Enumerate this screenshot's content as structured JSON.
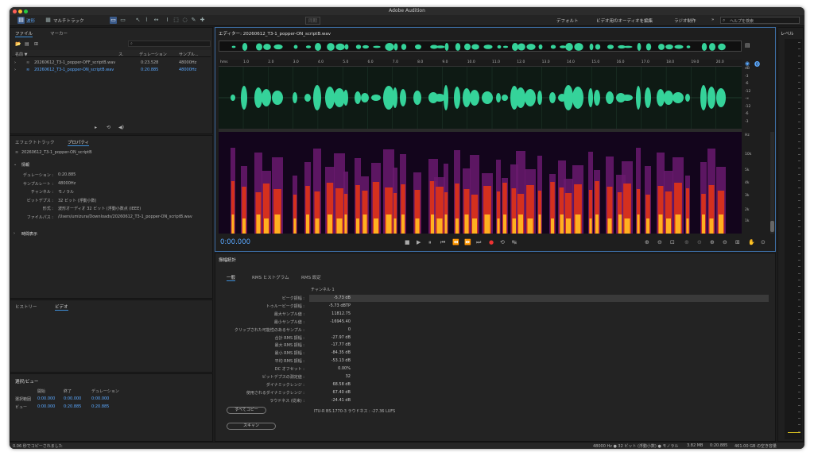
{
  "window": {
    "title": "Adobe Audition"
  },
  "toolbar": {
    "waveform_label": "波形",
    "multitrack_label": "マルチトラック",
    "time_label": "同期",
    "workspaces": [
      "デフォルト",
      "ビデオ用のオーディオを編集",
      "ラジオ制作"
    ],
    "more_label": "»",
    "search_placeholder": "ヘルプを検索"
  },
  "files_panel": {
    "tab_files": "ファイル",
    "tab_markers": "マーカー",
    "columns": [
      "名前 ▼",
      "ス.",
      "デュレーション",
      "サンプル..."
    ],
    "files": [
      {
        "name": "20260612_T3-1_popper-OFF_scriptB.wav",
        "duration": "0:23.528",
        "rate": "48000Hz"
      },
      {
        "name": "20260612_T3-1_popper-ON_scriptB.wav",
        "duration": "0:20.885",
        "rate": "48000Hz"
      }
    ]
  },
  "properties_panel": {
    "tab_effects": "エフェクトトラック",
    "tab_properties": "プロパティ",
    "file_name": "20260612_T3-1_popper-ON_scriptB",
    "section_info": "情報",
    "info": [
      {
        "label": "デュレーション :",
        "value": "0:20.885"
      },
      {
        "label": "サンプルレート :",
        "value": "48000Hz"
      },
      {
        "label": "チャンネル :",
        "value": "モノラル"
      },
      {
        "label": "ビットデプス :",
        "value": "32 ビット (浮動小数)"
      },
      {
        "label": "形式 :",
        "value": "波形オーディオ 32 ビット (浮動小数点 (IEEE)"
      },
      {
        "label": "ファイルパス :",
        "value": "/Users/umizura/Downloads/20260612_T3-1_popper-ON_scriptB.wav"
      }
    ],
    "section_time": "時間表示"
  },
  "history_panel": {
    "tab_history": "ヒストリー",
    "tab_video": "ビデオ"
  },
  "selection_panel": {
    "title": "選択/ビュー",
    "columns": [
      "開始",
      "終了",
      "デュレーション"
    ],
    "rows": [
      {
        "label": "選択範囲",
        "start": "0:00.000",
        "end": "0:00.000",
        "duration": "0:00.000"
      },
      {
        "label": "ビュー",
        "start": "0:00.000",
        "end": "0:20.885",
        "duration": "0:20.885"
      }
    ]
  },
  "editor": {
    "title": "エディター: 20260612_T3-1_popper-ON_scriptB.wav",
    "ruler_unit": "hms",
    "ruler_ticks": [
      "1.0",
      "2.0",
      "3.0",
      "4.0",
      "5.0",
      "6.0",
      "7.0",
      "8.0",
      "9.0",
      "10.0",
      "11.0",
      "12.0",
      "13.0",
      "14.0",
      "15.0",
      "16.0",
      "17.0",
      "18.0",
      "19.0",
      "20.0"
    ],
    "db_scale": [
      "dB",
      "-3",
      "-6",
      "-12",
      "-∞",
      "-12",
      "-6",
      "-3"
    ],
    "hz_scale": [
      "Hz",
      "10k",
      "5k",
      "4k",
      "3k",
      "2k",
      "1k"
    ],
    "timecode": "0:00.000",
    "wave_color": "#35d39a"
  },
  "stats": {
    "title": "振幅統計",
    "tabs": [
      "一般",
      "RMS ヒストグラム",
      "RMS 設定"
    ],
    "channel_header": "チャンネル 1",
    "rows": [
      {
        "label": "ピーク振幅 :",
        "value": "-5.73 dB"
      },
      {
        "label": "トゥルーピーク振幅 :",
        "value": "-5.73 dBTP"
      },
      {
        "label": "最大サンプル値 :",
        "value": "11812.75"
      },
      {
        "label": "最小サンプル値 :",
        "value": "-16945.40"
      },
      {
        "label": "クリップされた可能性のあるサンプル :",
        "value": "0"
      },
      {
        "label": "合計 RMS 振幅 :",
        "value": "-27.97 dB"
      },
      {
        "label": "最大 RMS 振幅 :",
        "value": "-17.77 dB"
      },
      {
        "label": "最小 RMS 振幅 :",
        "value": "-84.35 dB"
      },
      {
        "label": "平均 RMS 振幅 :",
        "value": "-53.13 dB"
      },
      {
        "label": "DC オフセット :",
        "value": "0.00%"
      },
      {
        "label": "ビットデプスの測定値 :",
        "value": "32"
      },
      {
        "label": "ダイナミックレンジ :",
        "value": "68.58 dB"
      },
      {
        "label": "使用されるダイナミックレンジ :",
        "value": "67.40 dB"
      },
      {
        "label": "ラウドネス (従来) :",
        "value": "-24.41 dB"
      }
    ],
    "loudness_note": "ITU-R BS.1770-3 ラウドネス : -27.36 LUFS",
    "copy_all": "すべてコピー",
    "scan": "スキャン"
  },
  "levels": {
    "title": "レベル"
  },
  "status": {
    "left": "0.06 秒でコピーされました",
    "format": "48000 Hz ● 32 ビット (浮動小数) ● モノラル",
    "size": "3.82 MB",
    "duration": "0:20.885",
    "free": "461.00 GB の空き容量"
  }
}
